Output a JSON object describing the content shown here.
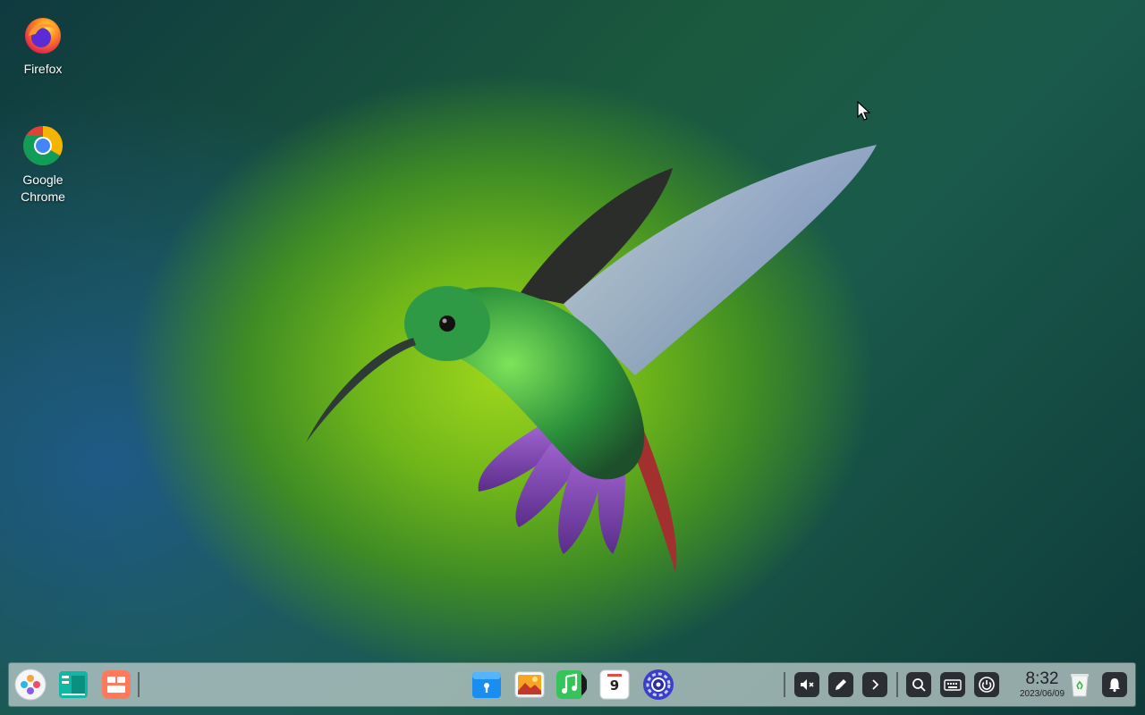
{
  "desktop": {
    "icons": [
      {
        "label": "Firefox"
      },
      {
        "label": "Google Chrome"
      }
    ]
  },
  "dock": {
    "left_apps": [
      "launcher-icon",
      "terminal-icon",
      "app-store-icon"
    ],
    "center_apps": [
      "file-manager-icon",
      "image-viewer-icon",
      "music-icon",
      "calendar-icon",
      "settings-icon"
    ],
    "calendar_day": "9",
    "tray_icons": [
      "volume-muted-icon",
      "pen-icon",
      "chevron-right-icon",
      "search-icon",
      "keyboard-icon",
      "power-icon"
    ],
    "clock": {
      "time": "8:32",
      "date": "2023/06/09"
    },
    "end_icons": [
      "trash-icon",
      "notification-bell-icon"
    ]
  },
  "colors": {
    "dock_bg": "#c8d2d2",
    "tray_bg": "#2b2f33",
    "accent": "#9ed61c"
  }
}
